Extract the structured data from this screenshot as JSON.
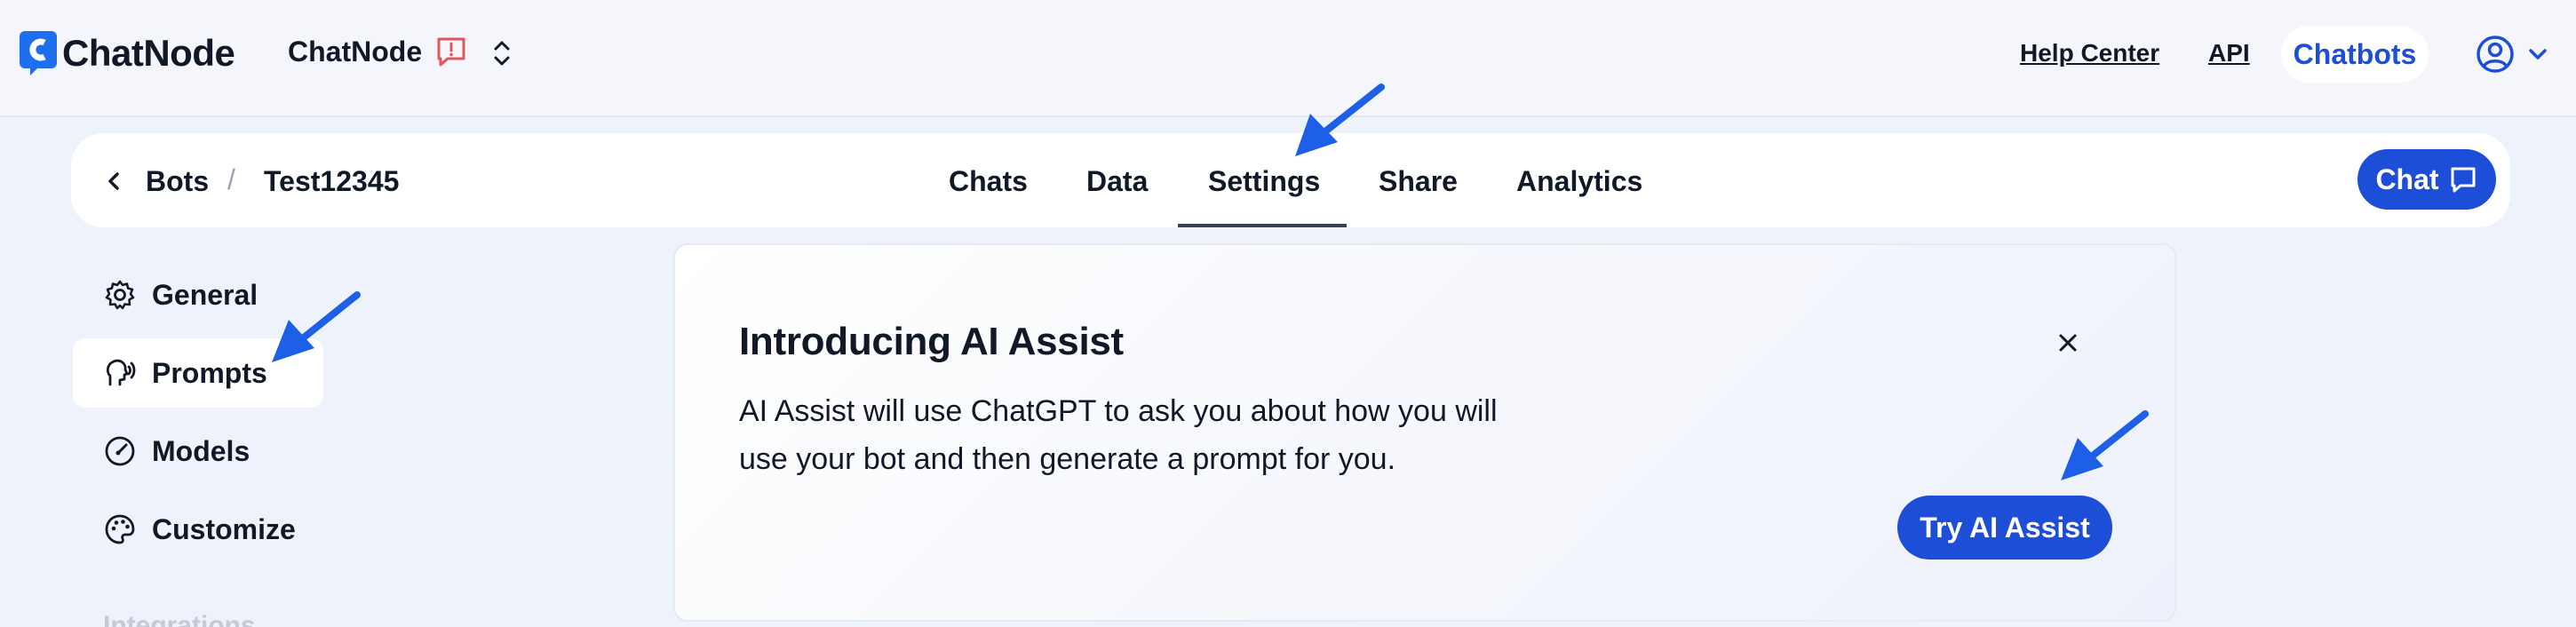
{
  "header": {
    "logo_text": "ChatNode",
    "workspace_name": "ChatNode",
    "help_center": "Help Center",
    "api": "API",
    "chatbots": "Chatbots"
  },
  "subnav": {
    "breadcrumb_root": "Bots",
    "breadcrumb_separator": "/",
    "bot_name": "Test12345",
    "tabs": [
      {
        "label": "Chats"
      },
      {
        "label": "Data"
      },
      {
        "label": "Settings",
        "active": true
      },
      {
        "label": "Share"
      },
      {
        "label": "Analytics"
      }
    ],
    "chat_button": "Chat"
  },
  "sidebar": {
    "items": [
      {
        "label": "General",
        "icon": "gear-icon"
      },
      {
        "label": "Prompts",
        "icon": "prompt-head-icon",
        "active": true
      },
      {
        "label": "Models",
        "icon": "gauge-icon"
      },
      {
        "label": "Customize",
        "icon": "palette-icon"
      }
    ],
    "next_section": "Integrations"
  },
  "card": {
    "title": "Introducing AI Assist",
    "body": "AI Assist will use ChatGPT to ask you about how you will use your bot and then generate a prompt for you.",
    "button": "Try AI Assist"
  },
  "colors": {
    "accent": "#1d4ed8",
    "page_bg": "#eef2fb",
    "arrow": "#1d5fe6"
  }
}
